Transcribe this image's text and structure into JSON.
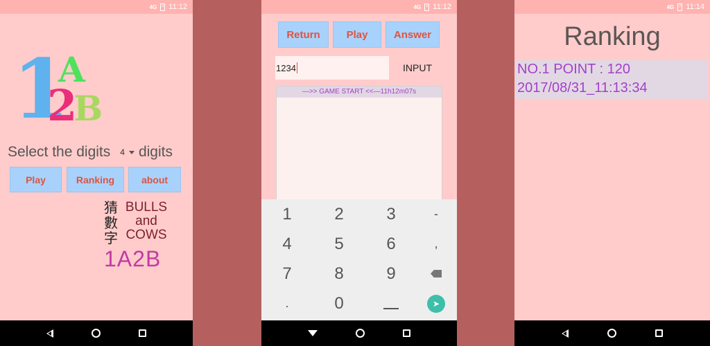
{
  "status": {
    "time1": "11:12",
    "time2": "11:12",
    "time3": "11:14",
    "signal": "4G"
  },
  "menu": {
    "logo": {
      "one": "1",
      "a": "A",
      "two": "2",
      "b": "B"
    },
    "select_prefix": "Select the digits",
    "select_value": "4",
    "select_suffix": "digits",
    "play_label": "Play",
    "ranking_label": "Ranking",
    "about_label": "about",
    "cjk_line1": "猜",
    "cjk_line2": "數",
    "cjk_line3": "字",
    "eng_line1": "BULLS",
    "eng_line2": "and",
    "eng_line3": "COWS",
    "big_title": "1A2B"
  },
  "game": {
    "return_label": "Return",
    "play_label": "Play",
    "answer_label": "Answer",
    "input_value": "1234",
    "input_button": "INPUT",
    "log_line": "—>>  GAME START <<—11h12m07s",
    "keys": [
      "1",
      "2",
      "3",
      "-",
      "4",
      "5",
      "6",
      ",",
      "7",
      "8",
      "9",
      "del",
      ".",
      "0",
      "space",
      "enter"
    ]
  },
  "ranking": {
    "title": "Ranking",
    "line1": "NO.1 POINT : 120",
    "line2": "2017/08/31_11:13:34"
  },
  "colors": {
    "accent": "#e0533f",
    "button_bg": "#a8d2fc",
    "phone_bg": "#ffcccb",
    "divider_bg": "#b5605e",
    "highlight": "#a440c8"
  }
}
